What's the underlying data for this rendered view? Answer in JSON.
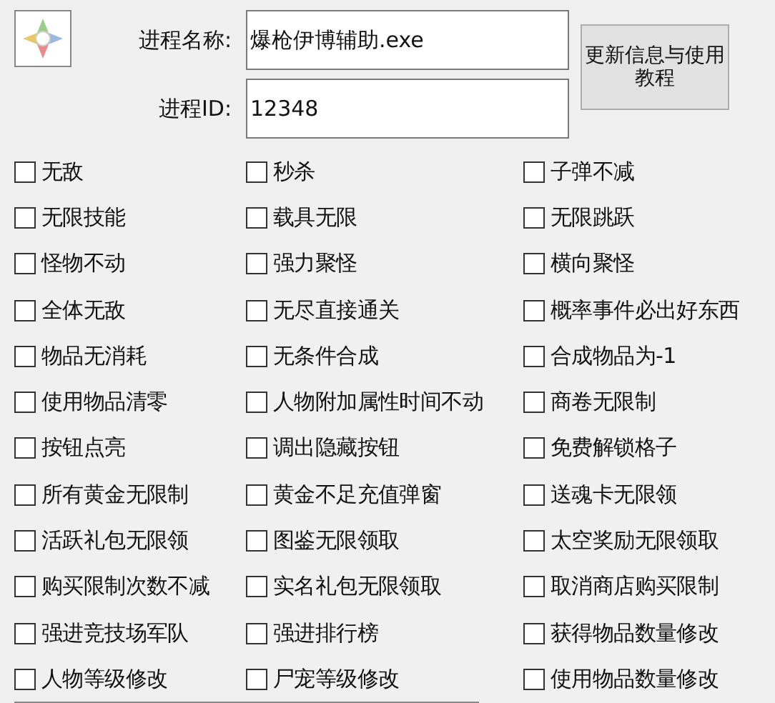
{
  "process_name": {
    "label": "进程名称:",
    "value": "爆枪伊博辅助.exe"
  },
  "process_id": {
    "label": "进程ID:",
    "value": "12348"
  },
  "update_button": "更新信息与使用教程",
  "options": [
    {
      "label": "无敌",
      "checked": false
    },
    {
      "label": "秒杀",
      "checked": false
    },
    {
      "label": "子弹不减",
      "checked": false
    },
    {
      "label": "无限技能",
      "checked": false
    },
    {
      "label": "载具无限",
      "checked": false
    },
    {
      "label": "无限跳跃",
      "checked": false
    },
    {
      "label": "怪物不动",
      "checked": false
    },
    {
      "label": "强力聚怪",
      "checked": false
    },
    {
      "label": "横向聚怪",
      "checked": false
    },
    {
      "label": "全体无敌",
      "checked": false
    },
    {
      "label": "无尽直接通关",
      "checked": false
    },
    {
      "label": "概率事件必出好东西",
      "checked": false
    },
    {
      "label": "物品无消耗",
      "checked": false
    },
    {
      "label": "无条件合成",
      "checked": false
    },
    {
      "label": "合成物品为-1",
      "checked": false
    },
    {
      "label": "使用物品清零",
      "checked": false
    },
    {
      "label": "人物附加属性时间不动",
      "checked": false
    },
    {
      "label": "商卷无限制",
      "checked": false
    },
    {
      "label": "按钮点亮",
      "checked": false
    },
    {
      "label": "调出隐藏按钮",
      "checked": false
    },
    {
      "label": "免费解锁格子",
      "checked": false
    },
    {
      "label": "所有黄金无限制",
      "checked": false
    },
    {
      "label": "黄金不足充值弹窗",
      "checked": false
    },
    {
      "label": "送魂卡无限领",
      "checked": false
    },
    {
      "label": "活跃礼包无限领",
      "checked": false
    },
    {
      "label": "图鉴无限领取",
      "checked": false
    },
    {
      "label": "太空奖励无限领取",
      "checked": false
    },
    {
      "label": "购买限制次数不减",
      "checked": false
    },
    {
      "label": "实名礼包无限领取",
      "checked": false
    },
    {
      "label": "取消商店购买限制",
      "checked": false
    },
    {
      "label": "强进竞技场军队",
      "checked": false
    },
    {
      "label": "强进排行榜",
      "checked": false
    },
    {
      "label": "获得物品数量修改",
      "checked": false
    },
    {
      "label": "人物等级修改",
      "checked": false
    },
    {
      "label": "尸宠等级修改",
      "checked": false
    },
    {
      "label": "使用物品数量修改",
      "checked": false
    }
  ]
}
